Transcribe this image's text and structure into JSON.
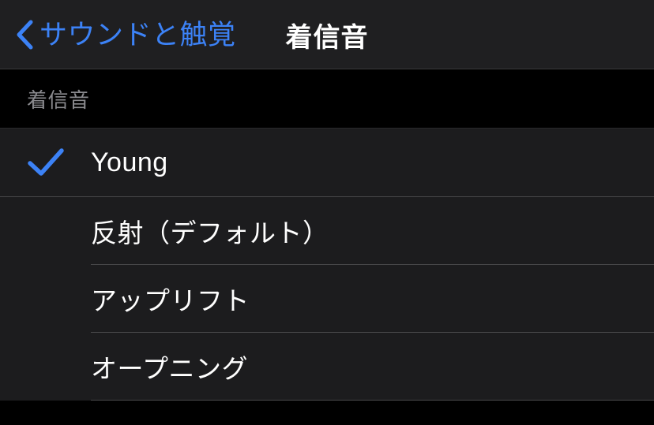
{
  "navbar": {
    "back_icon": "chevron-left-icon",
    "back_label": "サウンドと触覚",
    "title": "着信音"
  },
  "section": {
    "header_label": "着信音"
  },
  "selected_row": {
    "label": "Young",
    "check_icon": "checkmark-icon",
    "selected": true
  },
  "rows": [
    {
      "label": "反射（デフォルト）",
      "selected": false
    },
    {
      "label": "アップリフト",
      "selected": false
    },
    {
      "label": "オープニング",
      "selected": false
    }
  ],
  "colors": {
    "accent": "#3c82f6",
    "navbar_bg": "#1f1f21",
    "section_bg": "#000000",
    "row_bg": "#1c1c1e",
    "separator": "#48484a",
    "label_gray": "#8a8a8e",
    "text": "#ffffff"
  }
}
